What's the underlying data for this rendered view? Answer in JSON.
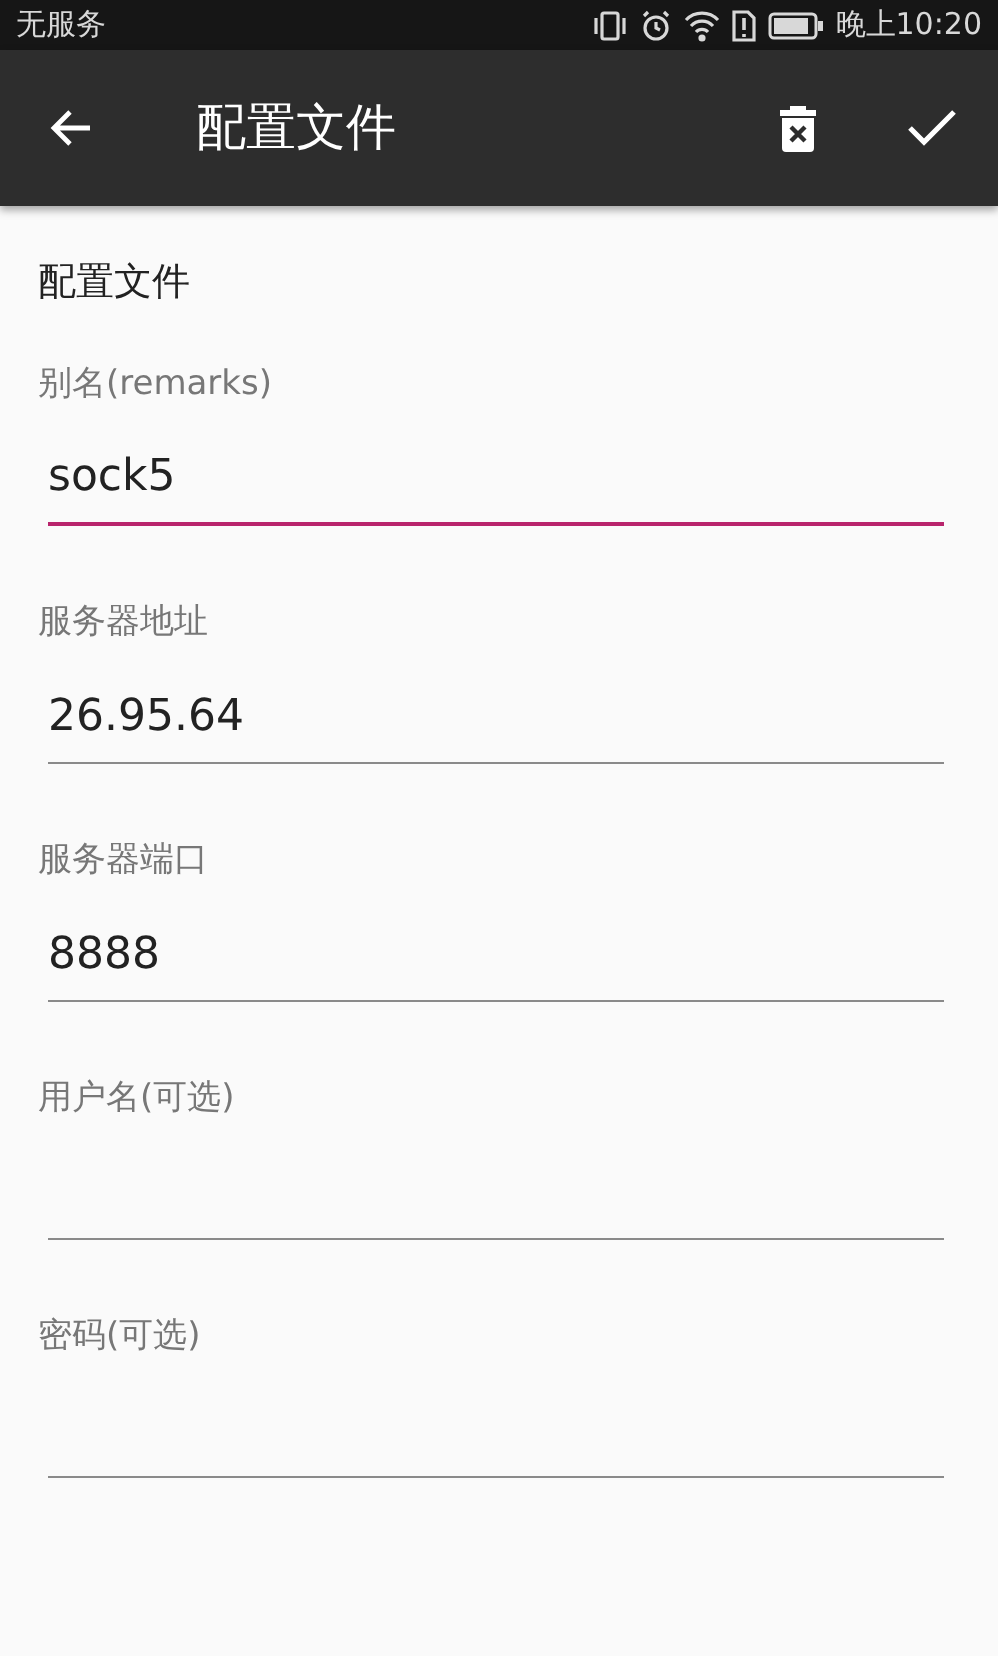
{
  "status_bar": {
    "carrier": "无服务",
    "time": "晚上10:20"
  },
  "app_bar": {
    "title": "配置文件"
  },
  "section_title": "配置文件",
  "fields": [
    {
      "label": "别名(remarks)",
      "value": "sock5",
      "focused": true
    },
    {
      "label": "服务器地址",
      "value": "26.95.64",
      "focused": false
    },
    {
      "label": "服务器端口",
      "value": "8888",
      "focused": false
    },
    {
      "label": "用户名(可选)",
      "focused": false
    },
    {
      "label": "密码(可选)",
      "focused": false
    }
  ]
}
